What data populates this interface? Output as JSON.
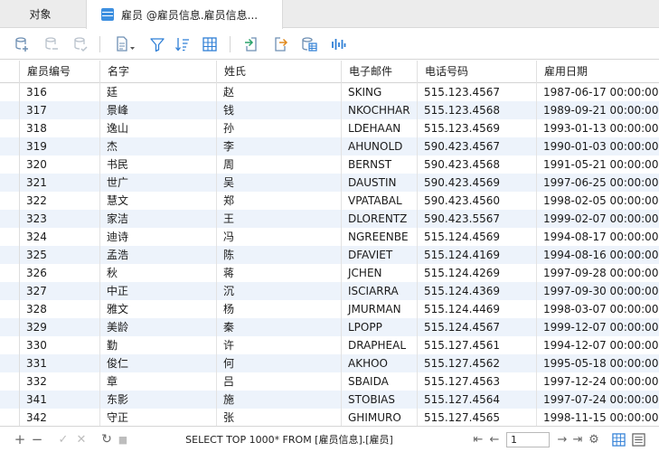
{
  "tabs": {
    "objects_label": "对象",
    "active_label": "雇员 @雇员信息.雇员信息..."
  },
  "toolbar": {
    "buttons": [
      {
        "icon": "add-record-icon"
      },
      {
        "icon": "delete-record-icon"
      },
      {
        "icon": "save-record-icon"
      },
      {
        "icon": "text-view-icon"
      },
      {
        "icon": "filter-icon"
      },
      {
        "icon": "sort-icon"
      },
      {
        "icon": "grid-view-icon"
      },
      {
        "icon": "import-icon"
      },
      {
        "icon": "export-icon"
      },
      {
        "icon": "data-generation-icon"
      },
      {
        "icon": "chart-icon"
      }
    ]
  },
  "grid": {
    "columns": [
      "雇员编号",
      "名字",
      "姓氏",
      "电子邮件",
      "电话号码",
      "雇用日期"
    ],
    "rows": [
      [
        "316",
        "廷",
        "赵",
        "SKING",
        "515.123.4567",
        "1987-06-17 00:00:00"
      ],
      [
        "317",
        "景峰",
        "钱",
        "NKOCHHAR",
        "515.123.4568",
        "1989-09-21 00:00:00"
      ],
      [
        "318",
        "逸山",
        "孙",
        "LDEHAAN",
        "515.123.4569",
        "1993-01-13 00:00:00"
      ],
      [
        "319",
        "杰",
        "李",
        "AHUNOLD",
        "590.423.4567",
        "1990-01-03 00:00:00"
      ],
      [
        "320",
        "书民",
        "周",
        "BERNST",
        "590.423.4568",
        "1991-05-21 00:00:00"
      ],
      [
        "321",
        "世广",
        "吴",
        "DAUSTIN",
        "590.423.4569",
        "1997-06-25 00:00:00"
      ],
      [
        "322",
        "慧文",
        "郑",
        "VPATABAL",
        "590.423.4560",
        "1998-02-05 00:00:00"
      ],
      [
        "323",
        "家洁",
        "王",
        "DLORENTZ",
        "590.423.5567",
        "1999-02-07 00:00:00"
      ],
      [
        "324",
        "迪诗",
        "冯",
        "NGREENBE",
        "515.124.4569",
        "1994-08-17 00:00:00"
      ],
      [
        "325",
        "孟浩",
        "陈",
        "DFAVIET",
        "515.124.4169",
        "1994-08-16 00:00:00"
      ],
      [
        "326",
        "秋",
        "蒋",
        "JCHEN",
        "515.124.4269",
        "1997-09-28 00:00:00"
      ],
      [
        "327",
        "中正",
        "沉",
        "ISCIARRA",
        "515.124.4369",
        "1997-09-30 00:00:00"
      ],
      [
        "328",
        "雅文",
        "杨",
        "JMURMAN",
        "515.124.4469",
        "1998-03-07 00:00:00"
      ],
      [
        "329",
        "美龄",
        "秦",
        "LPOPP",
        "515.124.4567",
        "1999-12-07 00:00:00"
      ],
      [
        "330",
        "勤",
        "许",
        "DRAPHEAL",
        "515.127.4561",
        "1994-12-07 00:00:00"
      ],
      [
        "331",
        "俊仁",
        "何",
        "AKHOO",
        "515.127.4562",
        "1995-05-18 00:00:00"
      ],
      [
        "332",
        "章",
        "吕",
        "SBAIDA",
        "515.127.4563",
        "1997-12-24 00:00:00"
      ],
      [
        "341",
        "东影",
        "施",
        "STOBIAS",
        "515.127.4564",
        "1997-07-24 00:00:00"
      ],
      [
        "342",
        "守正",
        "张",
        "GHIMURO",
        "515.127.4565",
        "1998-11-15 00:00:00"
      ]
    ]
  },
  "statusbar": {
    "sql_text": "SELECT TOP 1000* FROM [雇员信息].[雇员]",
    "page_value": "1",
    "add_glyph": "+",
    "remove_glyph": "−",
    "apply_glyph": "✓",
    "discard_glyph": "✕",
    "refresh_glyph": "↻",
    "stop_glyph": "■",
    "first_glyph": "⇤",
    "prev_glyph": "←",
    "next_glyph": "→",
    "last_glyph": "⇥",
    "settings_glyph": "⚙"
  },
  "colors": {
    "accent": "#2f7fd6",
    "row_alt": "#edf3fb"
  }
}
